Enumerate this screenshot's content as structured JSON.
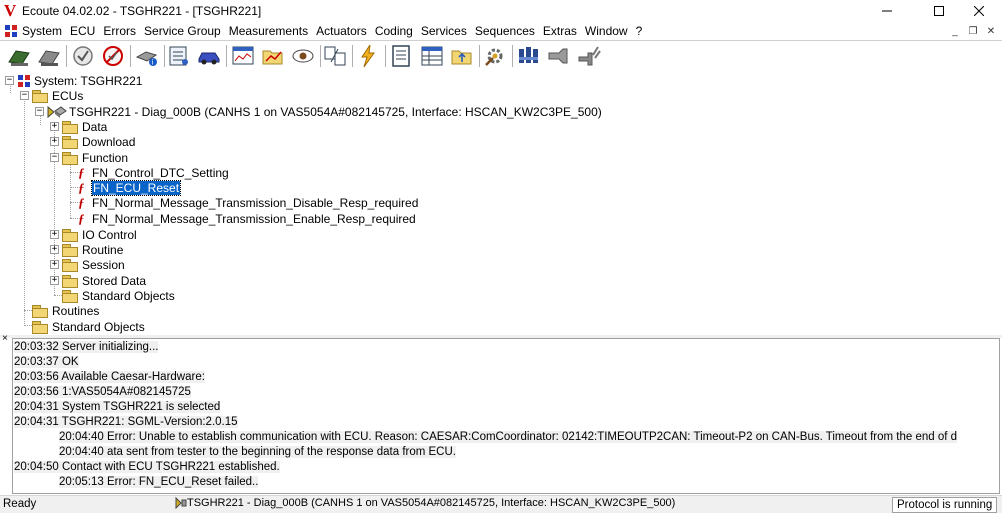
{
  "window": {
    "title": "Ecoute 04.02.02 - TSGHR221 - [TSGHR221]",
    "logo": "V"
  },
  "menubar": {
    "items": [
      "System",
      "ECU",
      "Errors",
      "Service Group",
      "Measurements",
      "Actuators",
      "Coding",
      "Services",
      "Sequences",
      "Extras",
      "Window",
      "?"
    ]
  },
  "tree": {
    "root": "System: TSGHR221",
    "ecus": "ECUs",
    "ecu_node": "TSGHR221 - Diag_000B (CANHS 1 on VAS5054A#082145725, Interface: HSCAN_KW2C3PE_500)",
    "data": "Data",
    "download": "Download",
    "function": "Function",
    "functions": [
      "FN_Control_DTC_Setting",
      "FN_ECU_Reset",
      "FN_Normal_Message_Transmission_Disable_Resp_required",
      "FN_Normal_Message_Transmission_Enable_Resp_required"
    ],
    "io_control": "IO Control",
    "routine": "Routine",
    "session": "Session",
    "stored_data": "Stored Data",
    "standard_objects_ecu": "Standard Objects",
    "routines": "Routines",
    "standard_objects": "Standard Objects"
  },
  "log": {
    "lines": [
      "20:03:32 Server initializing...",
      "20:03:37 OK",
      "20:03:56 Available Caesar-Hardware:",
      "20:03:56 1:VAS5054A#082145725",
      "20:04:31 System TSGHR221 is selected",
      "20:04:31 TSGHR221: SGML-Version:2.0.15",
      "20:04:40 Error: Unable to establish communication with ECU. Reason:  CAESAR:ComCoordinator: 02142:TIMEOUTP2CAN: Timeout-P2 on CAN-Bus. Timeout from the end of d",
      "20:04:40 ata sent from tester to the beginning of the response data from ECU.",
      "20:04:50 Contact with ECU TSGHR221 established.",
      "20:05:13 Error: FN_ECU_Reset failed.."
    ]
  },
  "statusbar": {
    "ready": "Ready",
    "ecu": "TSGHR221 - Diag_000B (CANHS 1 on VAS5054A#082145725, Interface: HSCAN_KW2C3PE_500)",
    "protocol": "Protocol is running"
  },
  "colors": {
    "selection": "#0a64c8",
    "logo": "#cc0000",
    "folder": "#f1d673"
  }
}
